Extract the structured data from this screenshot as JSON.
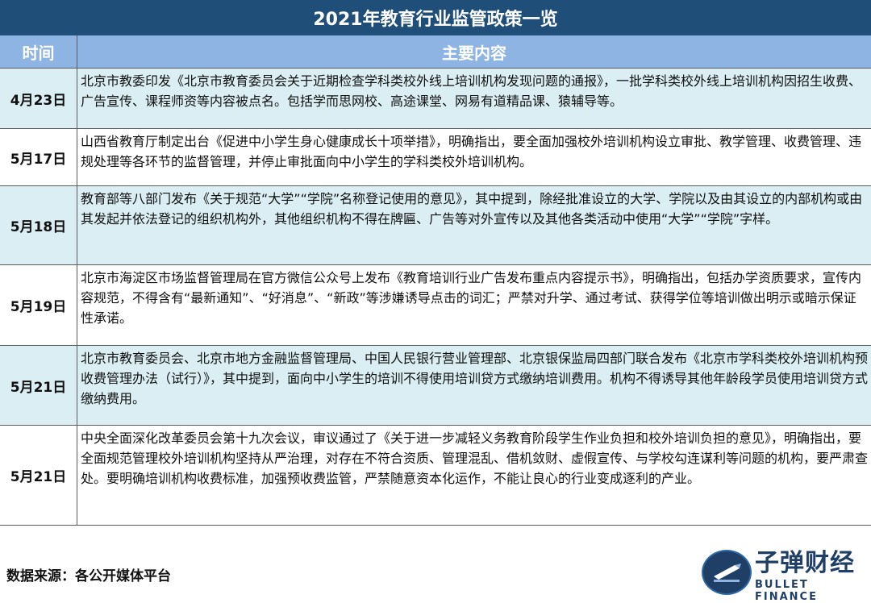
{
  "title": "2021年教育行业监管政策一览",
  "header": {
    "time": "时间",
    "content": "主要内容"
  },
  "rows": [
    {
      "date": "4月23日",
      "text": "北京市教委印发《北京市教育委员会关于近期检查学科类校外线上培训机构发现问题的通报》，一批学科类校外线上培训机构因招生收费、广告宣传、课程师资等内容被点名。包括学而思网校、高途课堂、网易有道精品课、猿辅导等。"
    },
    {
      "date": "5月17日",
      "text": "山西省教育厅制定出台《促进中小学生身心健康成长十项举措》，明确指出，要全面加强校外培训机构设立审批、教学管理、收费管理、违规处理等各环节的监督管理，并停止审批面向中小学生的学科类校外培训机构。"
    },
    {
      "date": "5月18日",
      "text": "教育部等八部门发布《关于规范“大学”“学院”名称登记使用的意见》，其中提到，除经批准设立的大学、学院以及由其设立的内部机构或由其发起并依法登记的组织机构外，其他组织机构不得在牌匾、广告等对外宣传以及其他各类活动中使用“大学”“学院”字样。"
    },
    {
      "date": "5月19日",
      "text": "北京市海淀区市场监督管理局在官方微信公众号上发布《教育培训行业广告发布重点内容提示书》，明确指出，包括办学资质要求，宣传内容规范，不得含有“最新通知”、“好消息”、“新政”等涉嫌诱导点击的词汇；严禁对升学、通过考试、获得学位等培训做出明示或暗示保证性承诺。"
    },
    {
      "date": "5月21日",
      "text": "北京市教育委员会、北京市地方金融监督管理局、中国人民银行营业管理部、北京银保监局四部门联合发布《北京市学科类校外培训机构预收费管理办法（试行）》，其中提到，面向中小学生的培训不得使用培训贷方式缴纳培训费用。机构不得诱导其他年龄段学员使用培训贷方式缴纳费用。"
    },
    {
      "date": "5月21日",
      "text": "中央全面深化改革委员会第十九次会议，审议通过了《关于进一步减轻义务教育阶段学生作业负担和校外培训负担的意见》，明确指出，要全面规范管理校外培训机构坚持从严治理，对存在不符合资质、管理混乱、借机敛财、虚假宣传、与学校勾连谋利等问题的机构，要严肃查处。要明确培训机构收费标准，加强预收费监管，严禁随意资本化运作，不能让良心的行业变成逐利的产业。"
    }
  ],
  "footer": {
    "source": "数据来源：各公开媒体平台",
    "brand_cn": "子弹财经",
    "brand_en": "BULLET FINANCE"
  },
  "colors": {
    "title_bg": "#1f4e79",
    "header_bg": "#8db4e2",
    "shade_row": "#daeef3"
  }
}
